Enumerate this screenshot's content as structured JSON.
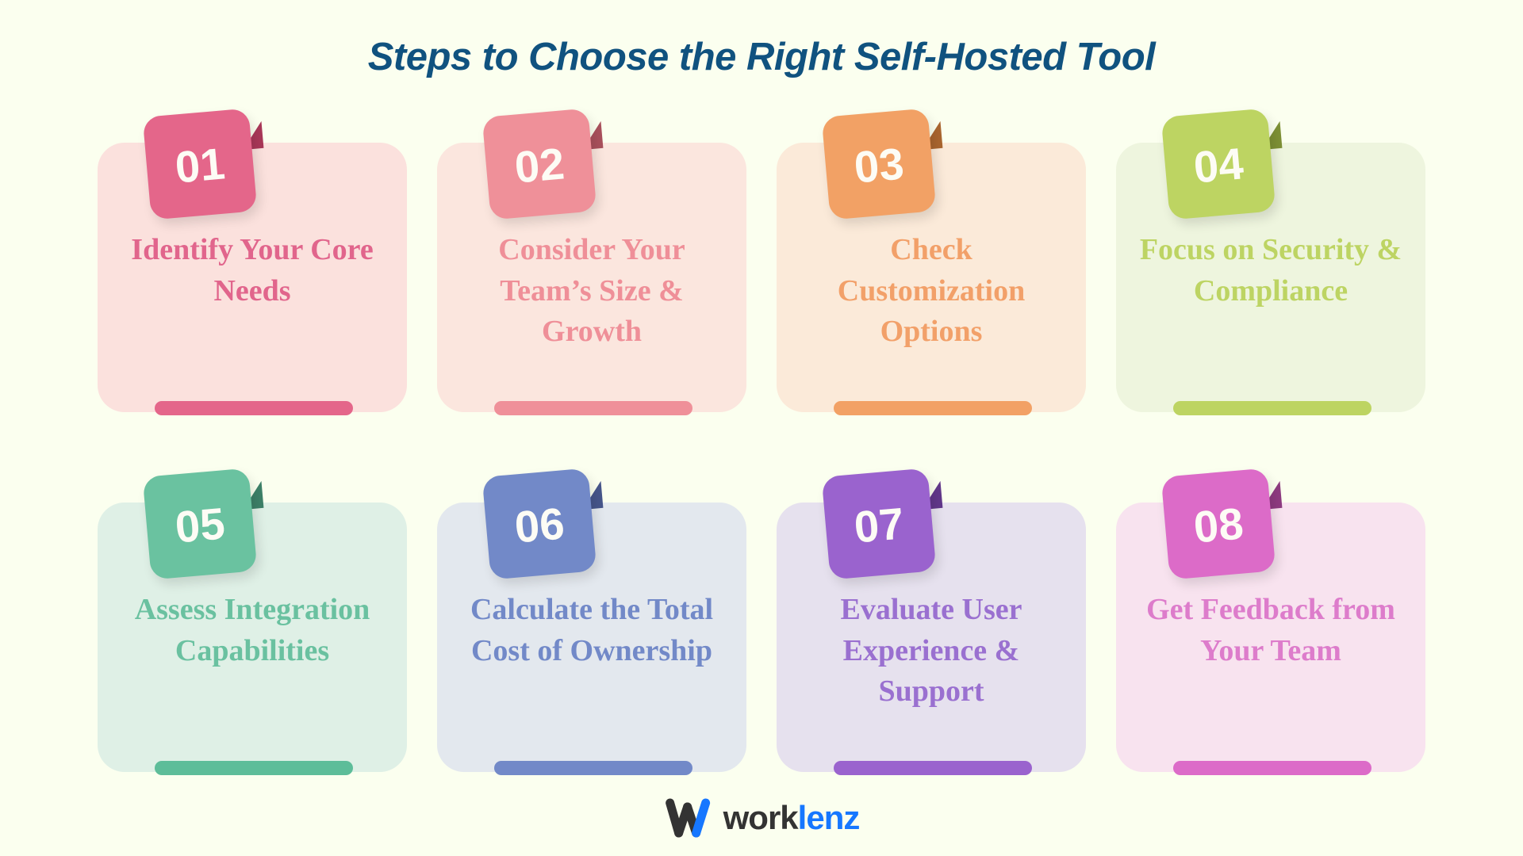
{
  "background_color": "#fbffef",
  "header": {
    "title": "Steps to Choose the Right Self-Hosted Tool",
    "title_color": "#10527f"
  },
  "steps": [
    {
      "number": "01",
      "title": "Identify Your Core Needs",
      "badge_color": "#e4668a",
      "fold_color": "#a93758",
      "card_color": "#fbe1dd",
      "text_color": "#e1658c",
      "accent_color": "#e4668a"
    },
    {
      "number": "02",
      "title": "Consider Your Team’s Size & Growth",
      "badge_color": "#ef9099",
      "fold_color": "#a9505c",
      "card_color": "#fbe6de",
      "text_color": "#ef8f98",
      "accent_color": "#ef9099"
    },
    {
      "number": "03",
      "title": "Check Customization Options",
      "badge_color": "#f2a165",
      "fold_color": "#a9652f",
      "card_color": "#fbead9",
      "text_color": "#f2a069",
      "accent_color": "#f2a165"
    },
    {
      "number": "04",
      "title": "Focus on Security & Compliance",
      "badge_color": "#bdd462",
      "fold_color": "#7d9035",
      "card_color": "#eef5de",
      "text_color": "#bdd463",
      "accent_color": "#bdd462"
    },
    {
      "number": "05",
      "title": "Assess Integration Capabilities",
      "badge_color": "#6ac2a0",
      "fold_color": "#3d8068",
      "card_color": "#dff0e6",
      "text_color": "#6ac1a0",
      "accent_color": "#5dbd99"
    },
    {
      "number": "06",
      "title": "Calculate the Total Cost of Ownership",
      "badge_color": "#7289c8",
      "fold_color": "#46558a",
      "card_color": "#e3e8ee",
      "text_color": "#7289c8",
      "accent_color": "#7289c8"
    },
    {
      "number": "07",
      "title": "Evaluate User Experience & Support",
      "badge_color": "#9a63ce",
      "fold_color": "#61378a",
      "card_color": "#e6e1ee",
      "text_color": "#9a70d0",
      "accent_color": "#9a63ce"
    },
    {
      "number": "08",
      "title": "Get Feedback from Your Team",
      "badge_color": "#dc6bc8",
      "fold_color": "#8e3b80",
      "card_color": "#f8e3ef",
      "text_color": "#dd7ccb",
      "accent_color": "#dc6bc8"
    }
  ],
  "logo": {
    "mark": "worklenz-w-mark-icon",
    "text_primary": "work",
    "text_accent": "lenz",
    "primary_color": "#333333",
    "accent_color": "#1677ff"
  }
}
